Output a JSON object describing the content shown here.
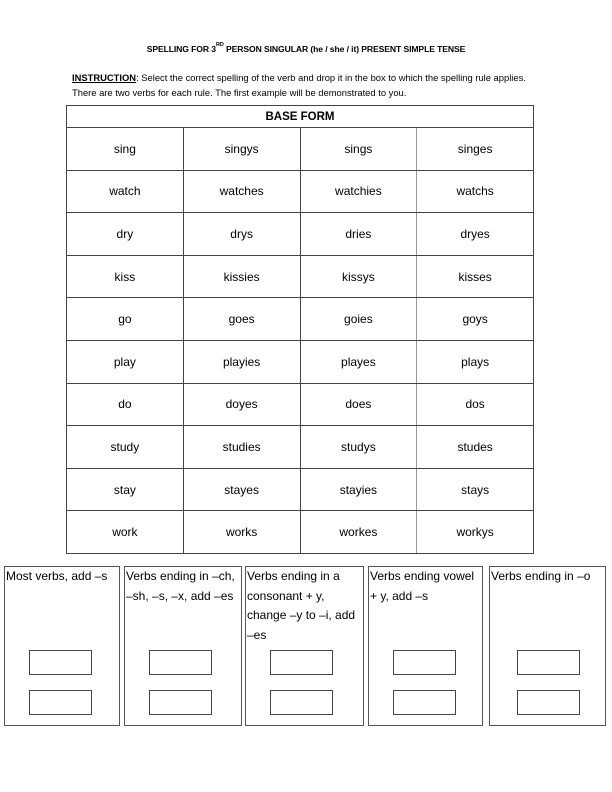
{
  "title": {
    "prefix": "SPELLING FOR 3",
    "superscript": "RD",
    "suffix": " PERSON SINGULAR (he / she / it) PRESENT SIMPLE TENSE"
  },
  "instruction": {
    "label": "INSTRUCTION",
    "text": ":  Select the correct spelling of the verb and drop it in the box to which the spelling rule applies.  There are two verbs for each rule.  The first example will be demonstrated to you."
  },
  "table": {
    "header": "BASE FORM",
    "rows": [
      [
        "sing",
        "singys",
        "sings",
        "singes"
      ],
      [
        "watch",
        "watches",
        "watchies",
        "watchs"
      ],
      [
        "dry",
        "drys",
        "dries",
        "dryes"
      ],
      [
        "kiss",
        "kissies",
        "kissys",
        "kisses"
      ],
      [
        "go",
        "goes",
        "goies",
        "goys"
      ],
      [
        "play",
        "playies",
        "playes",
        "plays"
      ],
      [
        "do",
        "doyes",
        "does",
        "dos"
      ],
      [
        "study",
        "studies",
        "studys",
        "studes"
      ],
      [
        "stay",
        "stayes",
        "stayies",
        "stays"
      ],
      [
        "work",
        "works",
        "workes",
        "workys"
      ]
    ]
  },
  "rules": [
    {
      "text": "Most verbs, add –s",
      "drop_boxes": [
        "",
        ""
      ]
    },
    {
      "text": "Verbs ending in –ch,\n–sh, –s, –x, add –es",
      "drop_boxes": [
        "",
        ""
      ]
    },
    {
      "text": "Verbs ending in a\nconsonant + y,\nchange –y to –i, add\n–es",
      "drop_boxes": [
        "",
        ""
      ]
    },
    {
      "text": "Verbs ending vowel\n+ y, add –s",
      "drop_boxes": [
        "",
        ""
      ]
    },
    {
      "text": "Verbs ending in  –o",
      "drop_boxes": [
        "",
        ""
      ]
    }
  ]
}
